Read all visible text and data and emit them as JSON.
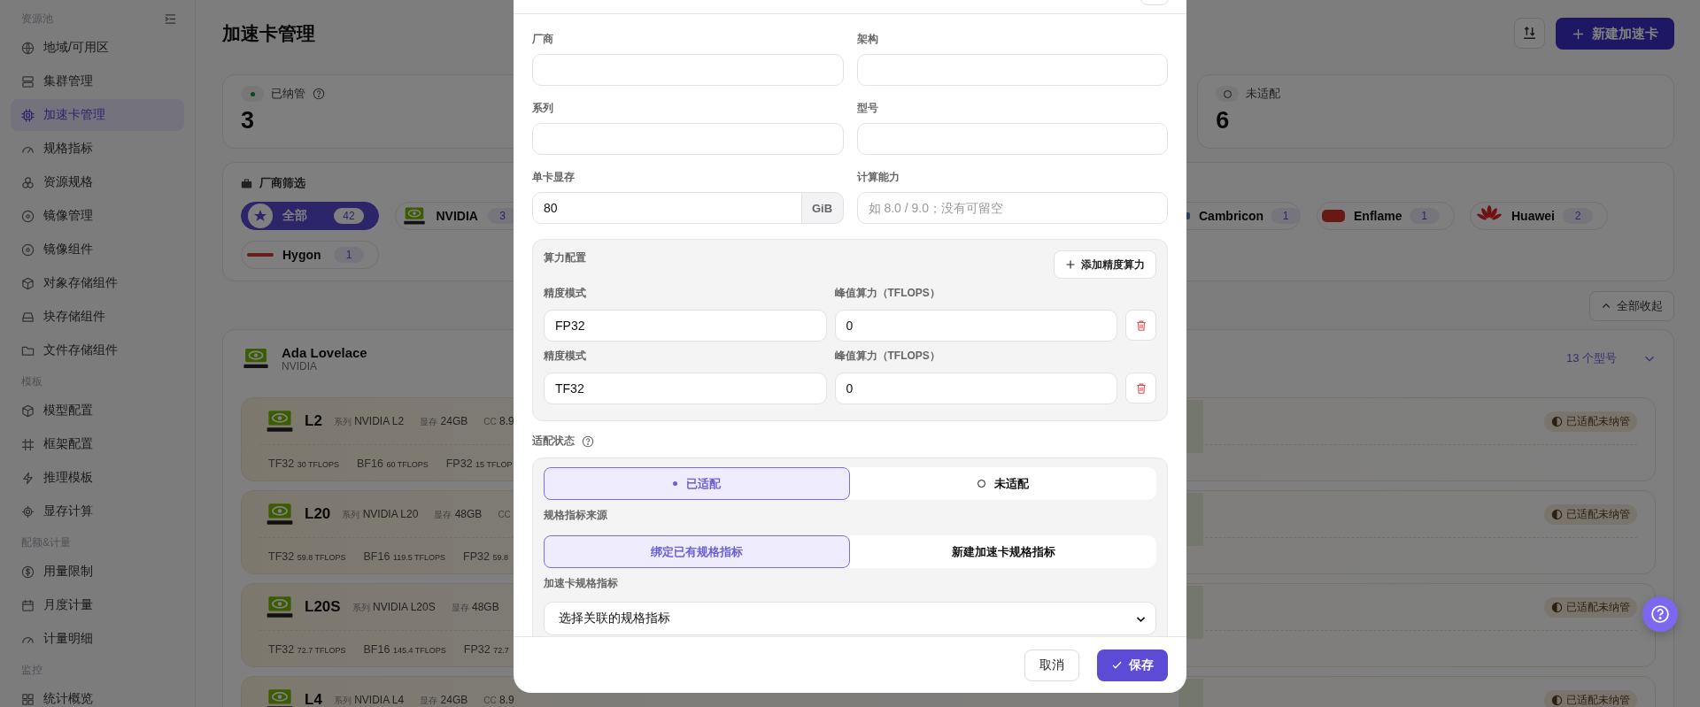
{
  "sidebar": {
    "sections": [
      {
        "title": "资源池",
        "items": [
          {
            "label": "地域/可用区",
            "selected": false
          },
          {
            "label": "集群管理",
            "selected": false
          },
          {
            "label": "加速卡管理",
            "selected": true
          },
          {
            "label": "规格指标",
            "selected": false
          },
          {
            "label": "资源规格",
            "selected": false
          },
          {
            "label": "镜像管理",
            "selected": false
          },
          {
            "label": "镜像组件",
            "selected": false
          },
          {
            "label": "对象存储组件",
            "selected": false
          },
          {
            "label": "块存储组件",
            "selected": false
          },
          {
            "label": "文件存储组件",
            "selected": false
          }
        ]
      },
      {
        "title": "模板",
        "items": [
          {
            "label": "模型配置",
            "selected": false
          },
          {
            "label": "框架配置",
            "selected": false
          },
          {
            "label": "推理模板",
            "selected": false
          },
          {
            "label": "显存计算",
            "selected": false
          }
        ]
      },
      {
        "title": "配额&计量",
        "items": [
          {
            "label": "用量限制",
            "selected": false
          },
          {
            "label": "月度计量",
            "selected": false
          },
          {
            "label": "计量明细",
            "selected": false
          }
        ]
      },
      {
        "title": "监控",
        "items": [
          {
            "label": "统计概览",
            "selected": false
          }
        ]
      }
    ]
  },
  "header": {
    "title": "加速卡管理",
    "primary_button": "新建加速卡"
  },
  "stats": [
    {
      "kind": "managed",
      "label": "已纳管",
      "value": "3"
    },
    {
      "kind": "unadapted",
      "label": "未适配",
      "value": "6"
    }
  ],
  "vendor_filter": {
    "title": "厂商筛选",
    "chips": [
      {
        "kind": "all",
        "label": "全部",
        "count": "42",
        "selected": true
      },
      {
        "kind": "nvidia",
        "label": "NVIDIA",
        "count": "3",
        "selected": false
      },
      {
        "kind": "cambricon",
        "label": "Cambricon",
        "count": "1",
        "selected": false
      },
      {
        "kind": "enflame",
        "label": "Enflame",
        "count": "1",
        "selected": false
      },
      {
        "kind": "huawei",
        "label": "Huawei",
        "count": "2",
        "selected": false
      },
      {
        "kind": "hygon",
        "label": "Hygon",
        "count": "1",
        "selected": false
      }
    ]
  },
  "collapse_all_button": "全部收起",
  "group": {
    "name": "Ada Lovelace",
    "vendor": "NVIDIA",
    "model_count": "13 个型号",
    "expanded": true,
    "cards": [
      {
        "name": "L2",
        "specs": [
          {
            "label": "系列",
            "value": "NVIDIA L2"
          },
          {
            "label": "显存",
            "value": "24GB"
          },
          {
            "label": "CC",
            "value": "8.9"
          }
        ],
        "perf": [
          {
            "label": "TF32",
            "value": "30 TFLOPS"
          },
          {
            "label": "BF16",
            "value": "60 TFLOPS"
          },
          {
            "label": "FP32",
            "value": "15 TFLOP"
          }
        ],
        "status": "已适配未纳管"
      },
      {
        "name": "L20",
        "specs": [
          {
            "label": "系列",
            "value": "NVIDIA L20"
          },
          {
            "label": "显存",
            "value": "48GB"
          },
          {
            "label": "CC"
          }
        ],
        "perf": [
          {
            "label": "TF32",
            "value": "59.8 TFLOPS"
          },
          {
            "label": "BF16",
            "value": "119.5 TFLOPS"
          },
          {
            "label": "FP32",
            "value": "59.8"
          }
        ],
        "status": "已适配未纳管"
      },
      {
        "name": "L20S",
        "specs": [
          {
            "label": "系列",
            "value": "NVIDIA L20S"
          },
          {
            "label": "显存",
            "value": "48GB"
          }
        ],
        "perf": [
          {
            "label": "TF32",
            "value": "72.7 TFLOPS"
          },
          {
            "label": "BF16",
            "value": "145.4 TFLOPS"
          },
          {
            "label": "FP32",
            "value": "72.7"
          }
        ],
        "status": "已适配未纳管"
      },
      {
        "name": "L4",
        "specs": [
          {
            "label": "系列",
            "value": "NVIDIA L4"
          },
          {
            "label": "显存",
            "value": "24GB"
          },
          {
            "label": "CC",
            "value": "8.9"
          }
        ],
        "status": "已适配未纳管"
      }
    ]
  },
  "dialog": {
    "fields": [
      {
        "label": "厂商"
      },
      {
        "label": "架构"
      },
      {
        "label": "系列"
      },
      {
        "label": "型号"
      },
      {
        "label": "单卡显存",
        "value": "80",
        "suffix": "GiB"
      },
      {
        "label": "计算能力",
        "placeholder": "如 8.0 / 9.0；没有可留空"
      }
    ],
    "compute": {
      "title": "算力配置",
      "add_button": "添加精度算力",
      "rows": [
        {
          "mode_label": "精度模式",
          "mode": "FP32",
          "peak_label": "峰值算力（TFLOPS）",
          "peak": "0"
        },
        {
          "mode_label": "精度模式",
          "mode": "TF32",
          "peak_label": "峰值算力（TFLOPS）",
          "peak": "0"
        }
      ]
    },
    "adapt": {
      "label": "适配状态",
      "options": [
        {
          "kind": "dot",
          "label": "已适配",
          "selected": true
        },
        {
          "kind": "ring",
          "label": "未适配",
          "selected": false
        }
      ],
      "source_label": "规格指标来源",
      "sources": [
        {
          "label": "绑定已有规格指标",
          "selected": true
        },
        {
          "label": "新建加速卡规格指标",
          "selected": false
        }
      ],
      "spec_label": "加速卡规格指标",
      "spec_select": "选择关联的规格指标"
    },
    "cancel_button": "取消",
    "save_button": "保存"
  }
}
